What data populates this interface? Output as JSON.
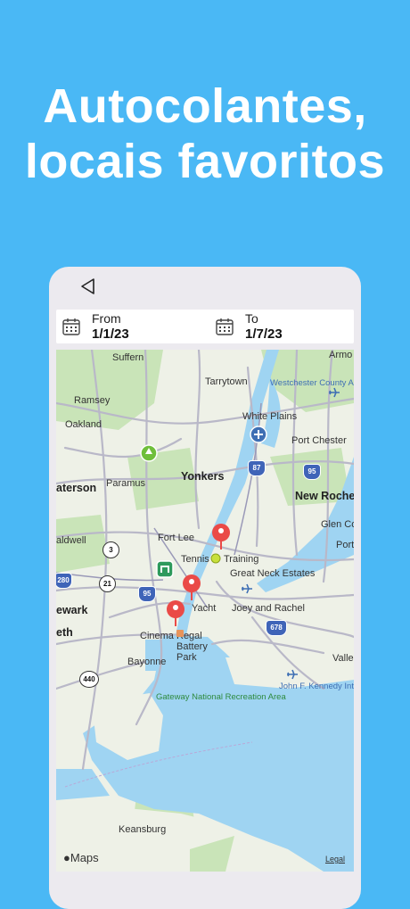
{
  "headline": {
    "line1": "Autocolantes,",
    "line2": "locais favoritos"
  },
  "date_bar": {
    "from": {
      "label": "From",
      "value": "1/1/23"
    },
    "to": {
      "label": "To",
      "value": "1/7/23"
    }
  },
  "map": {
    "place_labels": {
      "suffern": "Suffern",
      "tarrytown": "Tarrytown",
      "westchester_airport": "Westchester County Airport (HPN)",
      "ramsey": "Ramsey",
      "white_plains": "White Plains",
      "oakland": "Oakland",
      "port_chester": "Port Chester",
      "paterson": "aterson",
      "paramus": "Paramus",
      "yonkers": "Yonkers",
      "new_rochelle": "New Roche",
      "glen_cove": "Glen Co",
      "caldwell": "aldwell",
      "fort_lee": "Fort Lee",
      "port": "Port",
      "tennis": "Tennis",
      "training": "Training",
      "great_neck": "Great Neck Estates",
      "newark": "ewark",
      "yacht": "Yacht",
      "joey_rachel": "Joey and Rachel",
      "cinema": "Cinema",
      "regal_battery_park": "Regal Battery Park",
      "eth": "eth",
      "bayonne": "Bayonne",
      "valley": "Valle",
      "jfk": "John F. Kennedy International Airport (JFK)",
      "gateway": "Gateway National Recreation Area",
      "keansburg": "Keansburg",
      "armonk": "Armo"
    },
    "shields": {
      "i87": "87",
      "i95a": "95",
      "i95b": "95",
      "i280": "280",
      "i678": "678",
      "r3": "3",
      "r21": "21",
      "r440": "440"
    },
    "attribution": "Maps",
    "legal": "Legal",
    "colors": {
      "water": "#9fd4f2",
      "land": "#eef1e7",
      "park": "#c9e4b8",
      "road": "#b9b8c8",
      "pin": "#ea4a47"
    }
  }
}
